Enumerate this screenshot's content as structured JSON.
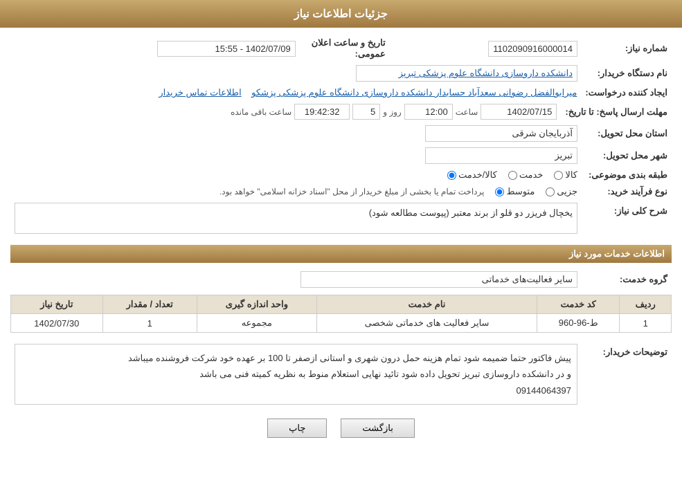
{
  "header": {
    "title": "جزئیات اطلاعات نیاز"
  },
  "fields": {
    "needNumber_label": "شماره نیاز:",
    "needNumber_value": "1102090916000014",
    "buyerOrg_label": "نام دستگاه خریدار:",
    "buyerOrg_value": "دانشکده داروسازی دانشگاه علوم پزشکی تبریز",
    "creator_label": "ایجاد کننده درخواست:",
    "creator_value": "میرابوالفضل رضوانی سعدآباد حسابدار دانشکده داروسازی دانشگاه علوم پزشکی پزشکو",
    "contact_link": "اطلاعات تماس خریدار",
    "responseDeadline_label": "مهلت ارسال پاسخ: تا تاریخ:",
    "deadlineDate": "1402/07/15",
    "deadlineTime_label": "ساعت",
    "deadlineTime": "12:00",
    "deadlineDays_label": "روز و",
    "deadlineDays": "5",
    "remainingTime": "19:42:32",
    "remainingTime_label": "ساعت باقی مانده",
    "province_label": "استان محل تحویل:",
    "province_value": "آذربایجان شرقی",
    "city_label": "شهر محل تحویل:",
    "city_value": "تبریز",
    "category_label": "طبقه بندی موضوعی:",
    "category_options": [
      "کالا",
      "خدمت",
      "کالا/خدمت"
    ],
    "category_selected": "کالا",
    "purchaseType_label": "نوع فرآیند خرید:",
    "purchaseType_options": [
      "جزیی",
      "متوسط"
    ],
    "purchaseType_selected": "متوسط",
    "purchaseType_note": "پرداخت تمام یا بخشی از مبلغ خریدار از محل \"اسناد خزانه اسلامی\" خواهد بود.",
    "needDescription_label": "شرح کلی نیاز:",
    "needDescription_value": "یخچال فریزر دو قلو از برند معتبر (پیوست مطالعه شود)",
    "serviceInfoSection": "اطلاعات خدمات مورد نیاز",
    "serviceGroup_label": "گروه خدمت:",
    "serviceGroup_value": "سایر فعالیت‌های خدماتی",
    "tableHeaders": [
      "ردیف",
      "کد خدمت",
      "نام خدمت",
      "واحد اندازه گیری",
      "تعداد / مقدار",
      "تاریخ نیاز"
    ],
    "tableRows": [
      {
        "row": "1",
        "code": "ط-96-960",
        "name": "سایر فعالیت های خدماتی شخصی",
        "unit": "مجموعه",
        "quantity": "1",
        "date": "1402/07/30"
      }
    ],
    "buyerNotes_label": "توضیحات خریدار:",
    "buyerNotes_value": "پیش فاکتور حتما ضمیمه شود تمام هزینه حمل درون شهری و استانی ازصفر تا 100 بر عهده خود شرکت فروشنده  میباشد\nو در دانشکده داروسازی تبریز تحویل داده شود تائید نهایی استعلام منوط به نظریه کمیته فنی می باشد\n09144064397",
    "dateAnnouncement_label": "تاریخ و ساعت اعلان عمومی:",
    "dateAnnouncement_value": "1402/07/09 - 15:55",
    "buttons": {
      "print": "چاپ",
      "back": "بازگشت"
    }
  }
}
